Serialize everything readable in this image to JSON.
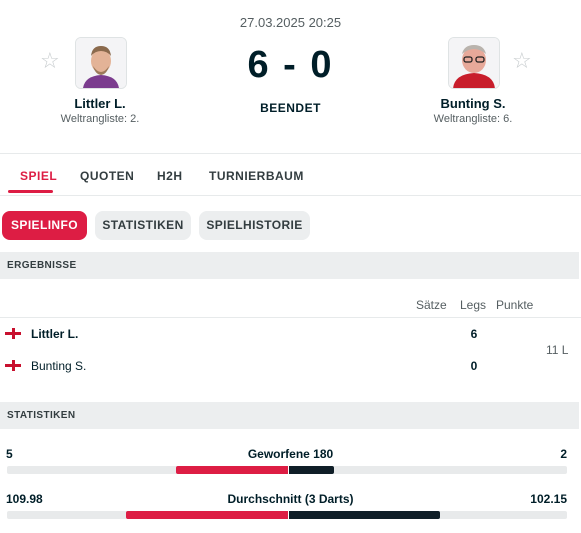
{
  "match": {
    "datetime": "27.03.2025 20:25",
    "score": "6 - 0",
    "status": "BEENDET"
  },
  "home": {
    "name": "Littler L.",
    "rank": "Weltrangliste: 2."
  },
  "away": {
    "name": "Bunting S.",
    "rank": "Weltrangliste: 6."
  },
  "tabs": [
    "SPIEL",
    "QUOTEN",
    "H2H",
    "TURNIERBAUM"
  ],
  "subtabs": [
    "SPIELINFO",
    "STATISTIKEN",
    "SPIELHISTORIE"
  ],
  "results": {
    "section_title": "ERGEBNISSE",
    "col_saetze": "Sätze",
    "col_legs": "Legs",
    "col_punkte": "Punkte",
    "format": "11 L",
    "rows": [
      {
        "name": "Littler L.",
        "legs": "6"
      },
      {
        "name": "Bunting S.",
        "legs": "0"
      }
    ]
  },
  "stats": {
    "section_title": "STATISTIKEN",
    "items": [
      {
        "label": "Geworfene 180",
        "home": "5",
        "away": "2",
        "home_share": 0.714,
        "away_share": 0.286
      },
      {
        "label": "Durchschnitt (3 Darts)",
        "home": "109.98",
        "away": "102.15",
        "home_share": 0.518,
        "away_share": 0.482
      }
    ]
  },
  "colors": {
    "accent": "#dd1d44",
    "dark": "#0f1e27",
    "section_bg": "#eceeef"
  }
}
